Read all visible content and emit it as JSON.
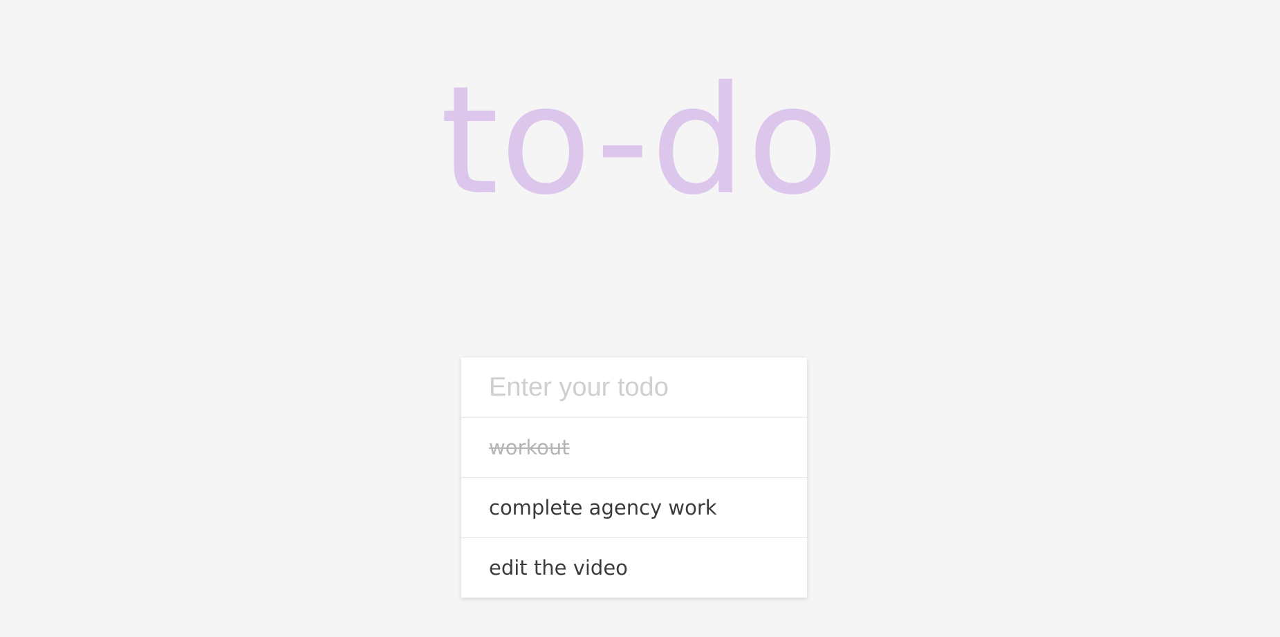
{
  "header": {
    "title": "to-do",
    "title_color": "#dcc6ec"
  },
  "input": {
    "placeholder": "Enter your todo",
    "value": ""
  },
  "todos": [
    {
      "text": "workout",
      "completed": true
    },
    {
      "text": "complete agency work",
      "completed": false
    },
    {
      "text": "edit the video",
      "completed": false
    }
  ]
}
